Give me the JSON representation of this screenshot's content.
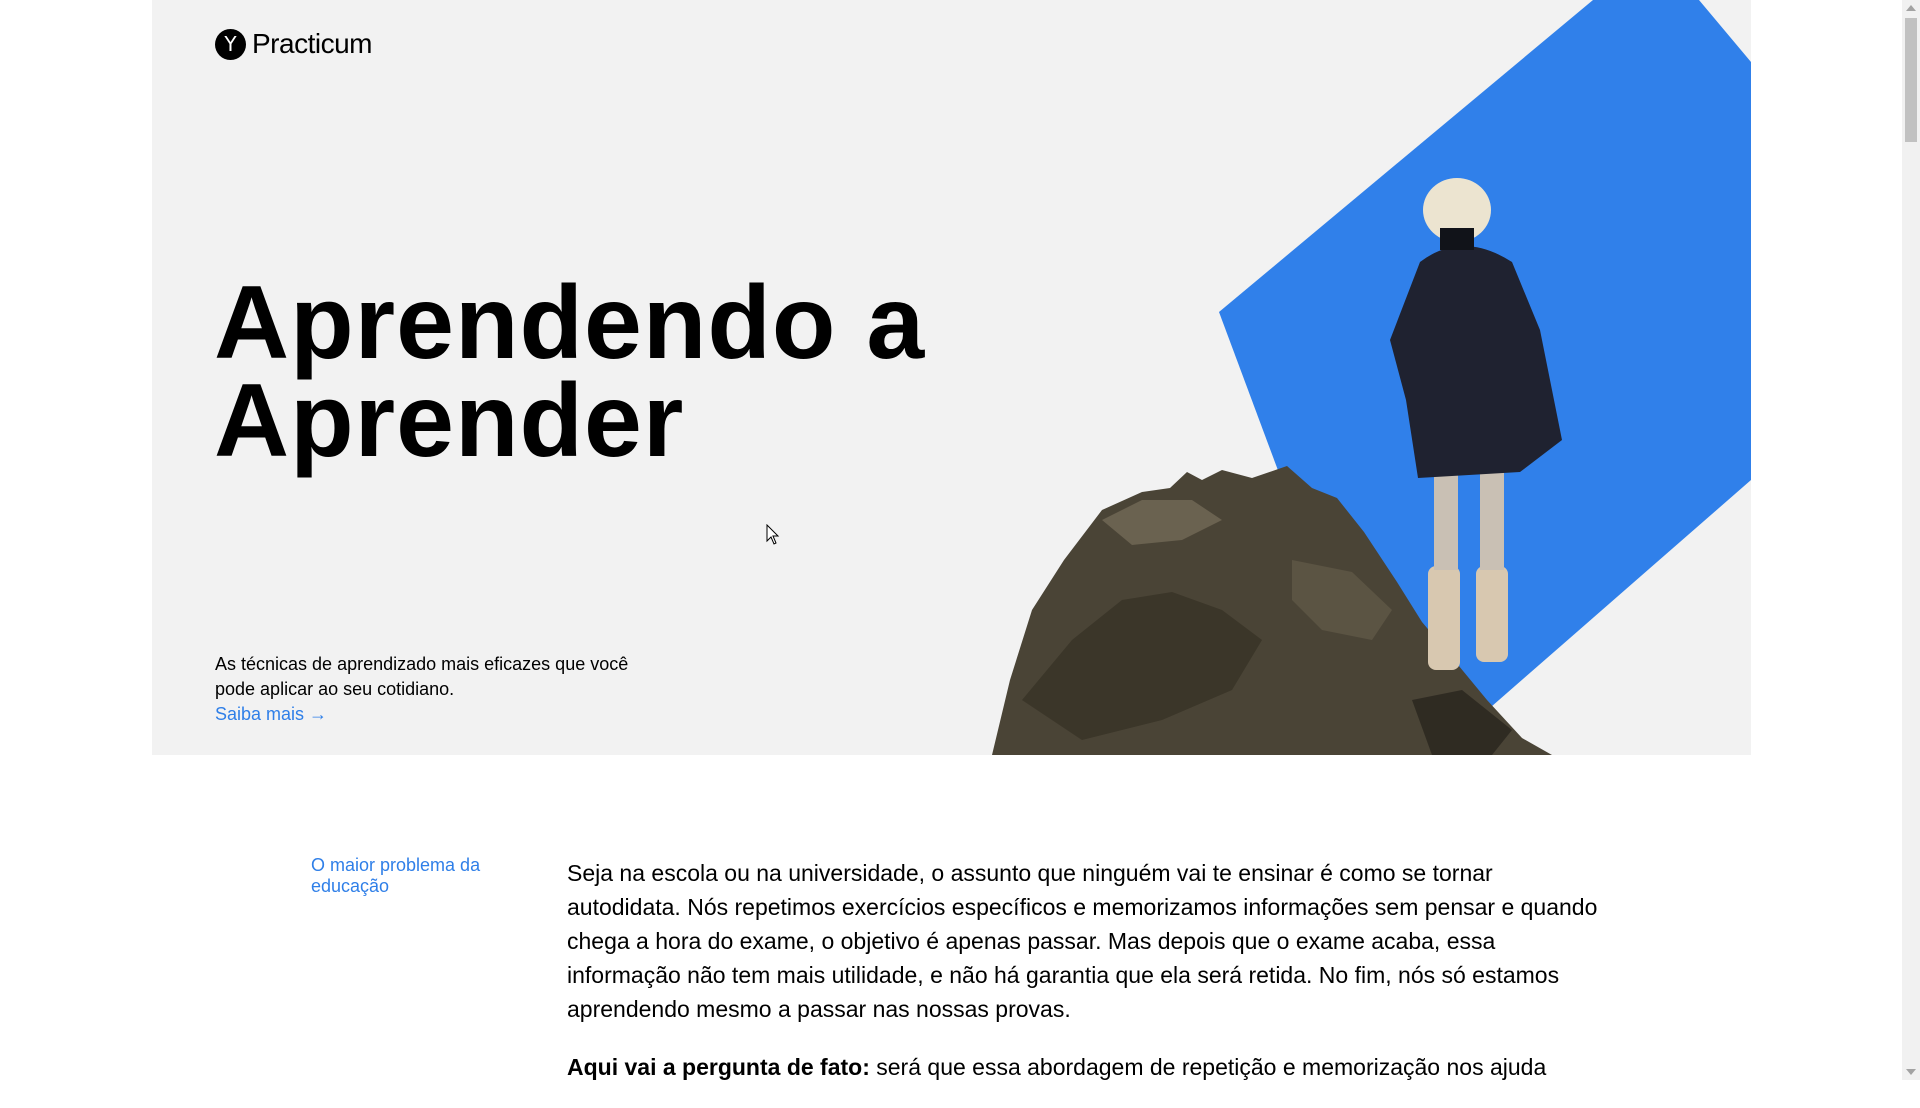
{
  "header": {
    "logo_mark": "Y",
    "logo_text": "Practicum"
  },
  "hero": {
    "title_line1": "Aprendendo a",
    "title_line2": "Aprender",
    "subtitle": "As técnicas de aprendizado mais eficazes que você pode aplicar ao seu cotidiano.",
    "link": "Saiba mais →"
  },
  "sidebar": {
    "link": "O maior problema da educação"
  },
  "article": {
    "p1": "Seja na escola ou na universidade, o assunto que ninguém vai te ensinar é como se tornar autodidata. Nós repetimos exercícios específicos e memorizamos informações sem pensar e quando chega a hora do exame, o objetivo é apenas passar. Mas depois que o exame acaba, essa informação não tem mais utilidade, e não há garantia que ela será retida. No fim, nós só estamos aprendendo mesmo a passar nas nossas provas.",
    "p2_bold": "Aqui vai a pergunta de fato:",
    "p2_rest": " será que essa abordagem de repetição e memorização nos ajuda"
  },
  "colors": {
    "accent": "#2f7fe8",
    "diamond": "#3080ea",
    "hero_bg": "#f2f2f2"
  },
  "icons": {
    "logo": "y-circle-icon",
    "cursor": "mouse-pointer-icon"
  }
}
